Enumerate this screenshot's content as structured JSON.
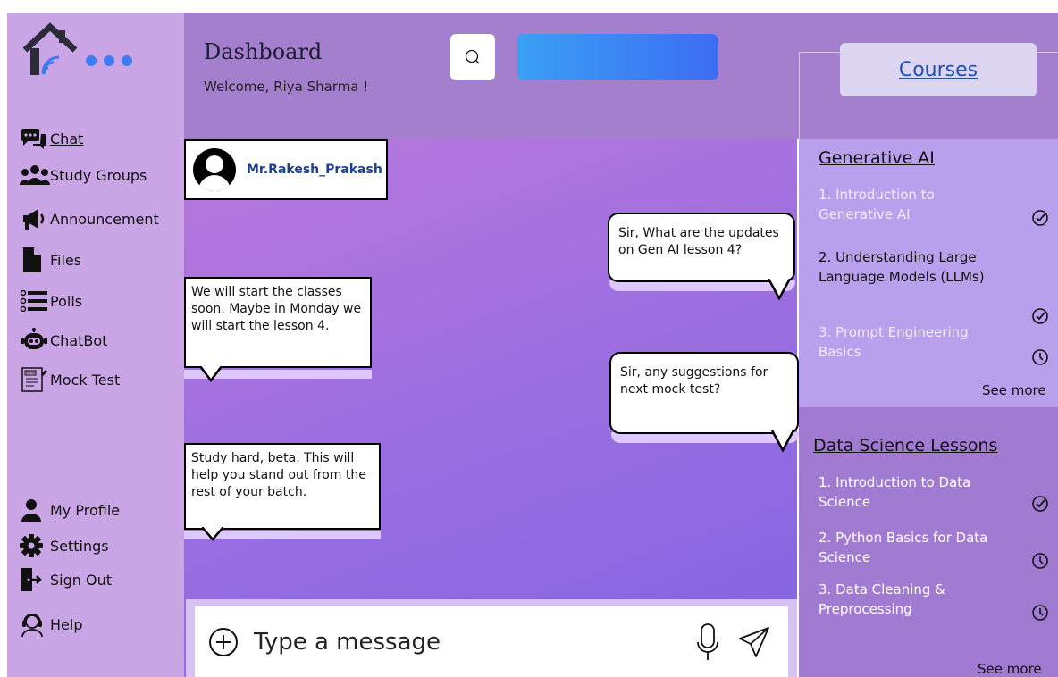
{
  "sidebar": {
    "items": [
      {
        "label": "Chat",
        "icon": "chat-bubbles-icon"
      },
      {
        "label": "Study Groups",
        "icon": "group-icon"
      },
      {
        "label": "Announcement",
        "icon": "megaphone-icon"
      },
      {
        "label": "Files",
        "icon": "file-icon"
      },
      {
        "label": "Polls",
        "icon": "poll-list-icon"
      },
      {
        "label": "ChatBot",
        "icon": "robot-icon"
      },
      {
        "label": "Mock Test",
        "icon": "exam-icon"
      }
    ],
    "bottom_items": [
      {
        "label": "My Profile",
        "icon": "user-icon"
      },
      {
        "label": "Settings",
        "icon": "gear-icon"
      },
      {
        "label": "Sign Out",
        "icon": "sign-out-icon"
      },
      {
        "label": "Help",
        "icon": "support-headset-icon"
      }
    ]
  },
  "header": {
    "title": "Dashboard",
    "welcome": "Welcome, Riya Sharma !"
  },
  "chat": {
    "contact_name": "Mr.Rakesh_Prakash",
    "messages": [
      {
        "side": "left",
        "text": "We will start the classes soon. Maybe in Monday we will start the lesson 4."
      },
      {
        "side": "left",
        "text": "Study hard, beta. This will help you stand out from the rest of your batch."
      },
      {
        "side": "right",
        "text": "Sir, What are the updates on Gen AI lesson 4?"
      },
      {
        "side": "right",
        "text": "Sir, any suggestions for next mock test?"
      }
    ],
    "input_placeholder": "Type a message"
  },
  "courses": {
    "button_label": "Courses",
    "sections": [
      {
        "title": "Generative AI",
        "lessons": [
          {
            "label": "1. Introduction to Generative AI",
            "status": "completed"
          },
          {
            "label": "2. Understanding Large Language Models (LLMs)",
            "status": "completed"
          },
          {
            "label": "3. Prompt Engineering Basics",
            "status": "pending"
          }
        ],
        "see_more": "See more"
      },
      {
        "title": "Data Science Lessons",
        "lessons": [
          {
            "label": "1. Introduction to Data Science",
            "status": "completed"
          },
          {
            "label": "2. Python Basics for Data Science",
            "status": "pending"
          },
          {
            "label": "3. Data Cleaning & Preprocessing",
            "status": "pending"
          }
        ],
        "see_more": "See more"
      }
    ]
  },
  "colors": {
    "sidebar": "#c9a5e6",
    "header": "#a47fce",
    "accent_blue": "#3d6df2",
    "link_blue": "#1f4fb8"
  }
}
